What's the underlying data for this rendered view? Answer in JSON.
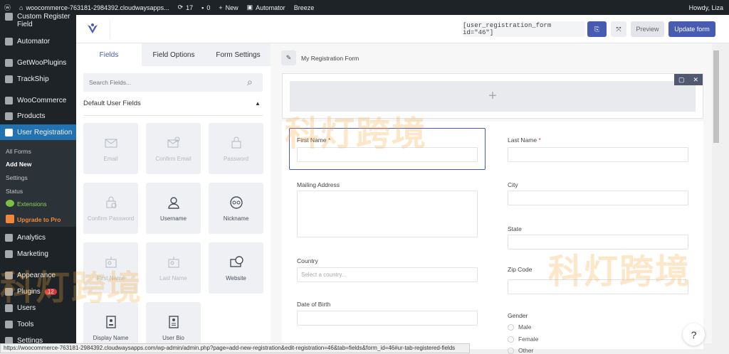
{
  "topbar": {
    "site": "woocommerce-763181-2984392.cloudwaysapps...",
    "updates": "17",
    "comments": "0",
    "new": "New",
    "automator": "Automator",
    "breeze": "Breeze",
    "howdy": "Howdy, Liza"
  },
  "sidebar": {
    "items": [
      {
        "label": "Custom Register Field"
      },
      {
        "label": "Automator"
      },
      {
        "label": "GetWooPlugins"
      },
      {
        "label": "TrackShip"
      },
      {
        "label": "WooCommerce"
      },
      {
        "label": "Products"
      },
      {
        "label": "User Registration"
      },
      {
        "label": "Analytics"
      },
      {
        "label": "Marketing"
      },
      {
        "label": "Appearance"
      },
      {
        "label": "Plugins",
        "badge": "12"
      },
      {
        "label": "Users"
      },
      {
        "label": "Tools"
      },
      {
        "label": "Settings"
      }
    ],
    "submenu": [
      "All Forms",
      "Add New",
      "Settings",
      "Status",
      "Extensions",
      "Upgrade to Pro"
    ]
  },
  "header": {
    "shortcode": "[user_registration_form id=\"46\"]",
    "preview": "Preview",
    "update": "Update form"
  },
  "panel": {
    "tabs": [
      "Fields",
      "Field Options",
      "Form Settings"
    ],
    "search_placeholder": "Search Fields...",
    "section": "Default User Fields",
    "fields": [
      "Email",
      "Confirm Email",
      "Password",
      "Confirm Password",
      "Username",
      "Nickname",
      "First Name",
      "Last Name",
      "Website",
      "Display Name",
      "User Bio"
    ]
  },
  "form": {
    "title": "My Registration Form",
    "first_name": "First Name",
    "last_name": "Last Name",
    "required": "*",
    "mailing": "Mailing Address",
    "city": "City",
    "state": "State",
    "country": "Country",
    "country_placeholder": "Select a country...",
    "zip": "Zip Code",
    "dob": "Date of Birth",
    "gender": "Gender",
    "genders": [
      "Male",
      "Female",
      "Other"
    ]
  },
  "help": "?",
  "status_url": "https://woocommerce-763181-2984392.cloudwaysapps.com/wp-admin/admin.php?page=add-new-registration&edit-registration=46&tab=fields&form_id=46#ur-tab-registered-fields",
  "watermark": "科灯跨境",
  "colors": {
    "accent": "#475bb2",
    "wp_blue": "#2271b1"
  }
}
